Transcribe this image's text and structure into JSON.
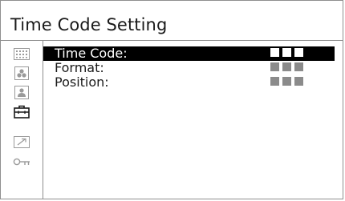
{
  "window": {
    "title": "Time Code Setting"
  },
  "sidebar": {
    "items": [
      {
        "icon": "grid-icon",
        "active": false
      },
      {
        "icon": "color-dots-icon",
        "active": false
      },
      {
        "icon": "person-icon",
        "active": false
      },
      {
        "icon": "toolbox-icon",
        "active": true
      },
      {
        "icon": "arrow-icon",
        "active": false
      },
      {
        "icon": "key-icon",
        "active": false
      }
    ]
  },
  "menu": {
    "items": [
      {
        "label": "Time Code:",
        "value_blocks": 3,
        "selected": true
      },
      {
        "label": "Format:",
        "value_blocks": 3,
        "selected": false
      },
      {
        "label": "Position:",
        "value_blocks": 3,
        "selected": false
      }
    ]
  },
  "colors": {
    "border": "#8f8f8f",
    "highlight_bg": "#000000",
    "highlight_text": "#ffffff",
    "value_block": "#8b8b8b",
    "text": "#1a1a1a"
  }
}
